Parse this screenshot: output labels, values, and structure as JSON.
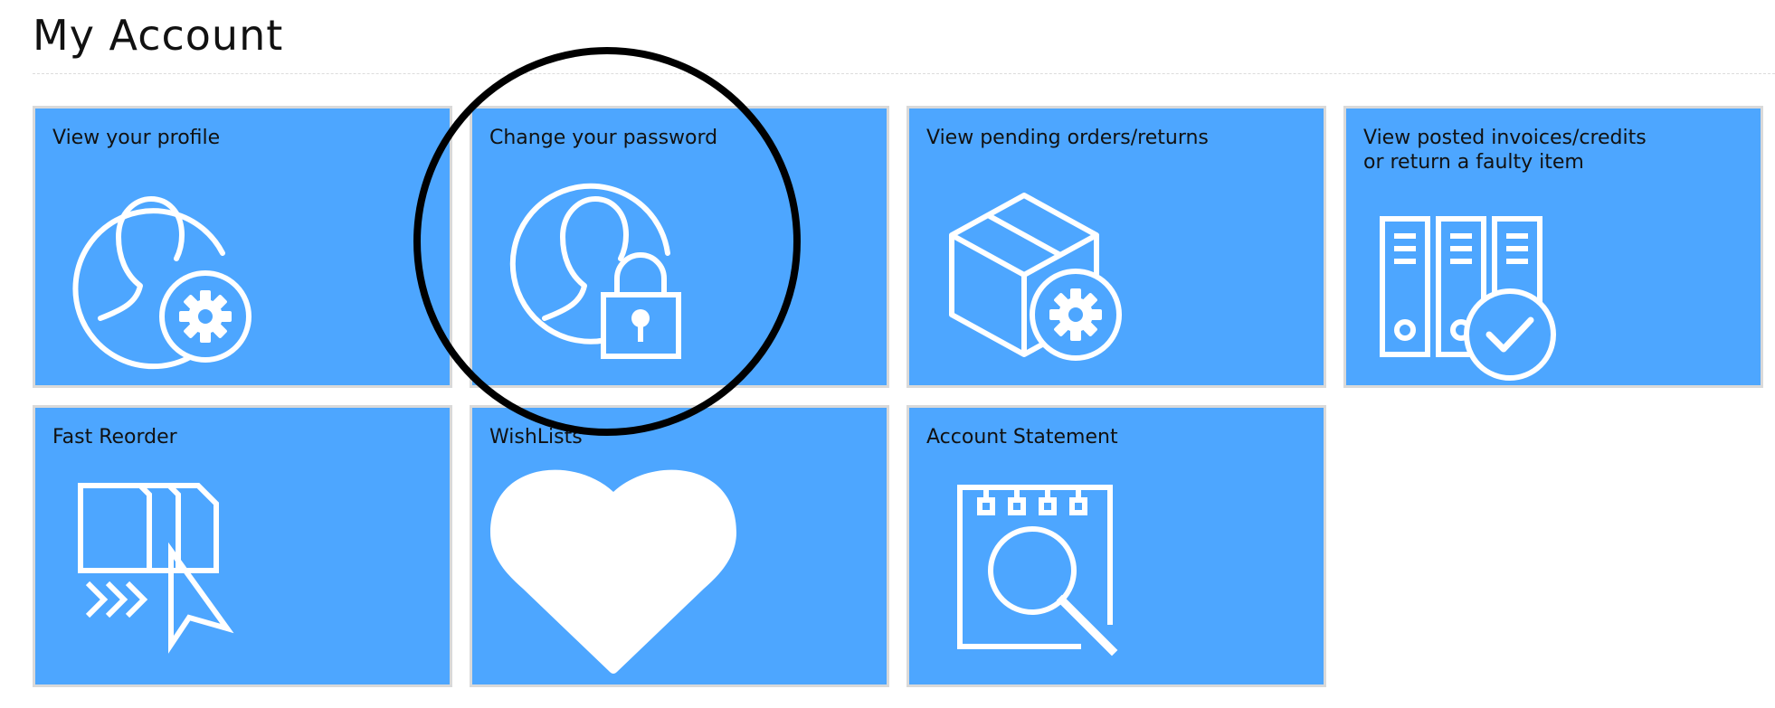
{
  "page": {
    "title": "My Account"
  },
  "tiles": [
    {
      "label": "View your profile",
      "icon": "user-settings-icon"
    },
    {
      "label": "Change your password",
      "icon": "user-lock-icon"
    },
    {
      "label": "View pending orders/returns",
      "icon": "box-settings-icon"
    },
    {
      "label": "View posted invoices/credits\nor return a faulty item",
      "icon": "binders-check-icon"
    },
    {
      "label": "Fast Reorder",
      "icon": "reorder-cursor-icon"
    },
    {
      "label": "WishLists",
      "icon": "heart-icon"
    },
    {
      "label": "Account Statement",
      "icon": "notepad-search-icon"
    }
  ],
  "colors": {
    "tile_background": "#4da6ff",
    "tile_border": "#d9d9d9",
    "icon": "#ffffff",
    "annotation": "#000000"
  }
}
